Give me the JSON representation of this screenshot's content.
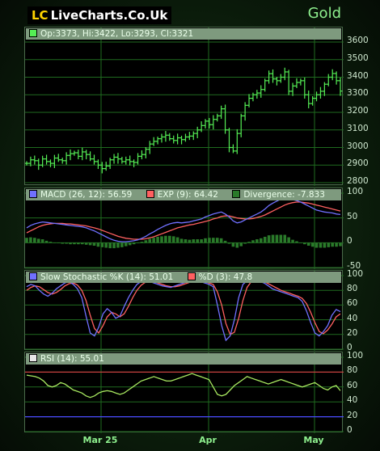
{
  "logo": {
    "lc": "LC",
    "text": "LiveCharts.Co.Uk"
  },
  "instrument": "Gold",
  "colors": {
    "up": "#55ee55",
    "macd": "#7070ff",
    "signal": "#ff6060",
    "hist": "#2a7a2a",
    "rsi": "#a8e860",
    "grid": "#1f6b1f",
    "ref_red": "#c84040",
    "ref_blue": "#4a4aff"
  },
  "x_labels": [
    "Mar 25",
    "Apr",
    "May"
  ],
  "chart_data": [
    {
      "type": "line",
      "style": "ohlc-bars",
      "legend": "Op:3373, Hi:3422, Lo:3293, Cl:3321",
      "y_ticks": [
        "3600",
        "3500",
        "3400",
        "3300",
        "3200",
        "3100",
        "3000",
        "2900",
        "2800"
      ],
      "ylim": [
        2800,
        3600
      ],
      "closes": [
        2910,
        2930,
        2925,
        2900,
        2935,
        2920,
        2910,
        2940,
        2930,
        2925,
        2955,
        2965,
        2970,
        2950,
        2975,
        2960,
        2935,
        2920,
        2900,
        2880,
        2895,
        2930,
        2945,
        2935,
        2920,
        2930,
        2920,
        2915,
        2950,
        2960,
        2990,
        3020,
        3035,
        3050,
        3060,
        3070,
        3050,
        3040,
        3055,
        3045,
        3060,
        3065,
        3080,
        3100,
        3125,
        3150,
        3130,
        3160,
        3180,
        3220,
        3100,
        3000,
        2980,
        3080,
        3180,
        3240,
        3280,
        3300,
        3310,
        3330,
        3380,
        3420,
        3390,
        3380,
        3400,
        3430,
        3320,
        3350,
        3370,
        3380,
        3300,
        3250,
        3280,
        3300,
        3320,
        3360,
        3400,
        3421,
        3380,
        3321
      ]
    },
    {
      "type": "line",
      "legend": [
        "MACD (26, 12): 56.59",
        "EXP (9): 64.42",
        "Divergence: -7.833"
      ],
      "y_ticks": [
        "100",
        "50",
        "0",
        "-50"
      ],
      "ylim": [
        -50,
        100
      ],
      "macd": [
        30,
        35,
        38,
        40,
        42,
        41,
        40,
        39,
        38,
        37,
        36,
        35,
        34,
        33,
        32,
        30,
        27,
        24,
        20,
        16,
        12,
        8,
        5,
        3,
        2,
        2,
        3,
        4,
        6,
        9,
        13,
        18,
        22,
        27,
        31,
        35,
        38,
        40,
        41,
        40,
        41,
        42,
        44,
        46,
        48,
        52,
        55,
        58,
        60,
        62,
        58,
        52,
        44,
        40,
        42,
        46,
        50,
        54,
        58,
        62,
        68,
        75,
        80,
        84,
        88,
        92,
        90,
        87,
        85,
        82,
        78,
        74,
        70,
        66,
        64,
        62,
        61,
        60,
        58,
        57
      ],
      "signal": [
        20,
        24,
        28,
        32,
        35,
        37,
        38,
        39,
        39,
        39,
        38,
        38,
        37,
        36,
        35,
        34,
        32,
        30,
        28,
        25,
        22,
        19,
        16,
        13,
        11,
        9,
        8,
        7,
        7,
        7,
        8,
        10,
        12,
        15,
        18,
        21,
        24,
        27,
        30,
        32,
        34,
        36,
        37,
        39,
        41,
        43,
        45,
        48,
        50,
        53,
        54,
        54,
        52,
        50,
        49,
        48,
        48,
        49,
        51,
        53,
        56,
        60,
        64,
        68,
        72,
        76,
        79,
        81,
        82,
        82,
        81,
        80,
        78,
        76,
        74,
        72,
        70,
        68,
        66,
        64
      ]
    },
    {
      "type": "line",
      "legend": [
        "Slow Stochastic %K (14): 51.01",
        "%D (3): 47.8"
      ],
      "y_ticks": [
        "100",
        "80",
        "60",
        "40",
        "20",
        "0"
      ],
      "ylim": [
        0,
        100
      ],
      "k": [
        85,
        88,
        86,
        80,
        75,
        72,
        76,
        82,
        86,
        90,
        92,
        88,
        82,
        70,
        45,
        22,
        18,
        30,
        48,
        55,
        50,
        42,
        45,
        58,
        70,
        80,
        88,
        92,
        93,
        92,
        90,
        88,
        86,
        85,
        84,
        86,
        88,
        90,
        92,
        93,
        94,
        92,
        90,
        88,
        85,
        60,
        32,
        12,
        18,
        40,
        70,
        88,
        93,
        95,
        94,
        92,
        90,
        86,
        82,
        80,
        78,
        76,
        74,
        72,
        70,
        65,
        52,
        36,
        22,
        18,
        24,
        32,
        46,
        54,
        51
      ],
      "d": [
        80,
        84,
        86,
        85,
        81,
        77,
        75,
        77,
        81,
        86,
        89,
        90,
        87,
        80,
        66,
        46,
        28,
        22,
        32,
        44,
        50,
        48,
        44,
        48,
        58,
        70,
        80,
        87,
        91,
        92,
        92,
        90,
        88,
        86,
        85,
        85,
        86,
        88,
        90,
        92,
        93,
        93,
        92,
        90,
        88,
        78,
        60,
        35,
        20,
        23,
        42,
        66,
        84,
        92,
        94,
        94,
        92,
        89,
        86,
        83,
        80,
        78,
        76,
        74,
        72,
        69,
        62,
        50,
        36,
        24,
        21,
        26,
        34,
        44,
        48
      ]
    },
    {
      "type": "line",
      "legend": [
        "RSI (14): 55.01"
      ],
      "y_ticks": [
        "100",
        "80",
        "60",
        "40",
        "20",
        "0"
      ],
      "ylim": [
        0,
        100
      ],
      "ref_lines": [
        80,
        20
      ],
      "rsi": [
        76,
        75,
        74,
        72,
        68,
        62,
        60,
        62,
        66,
        64,
        60,
        56,
        54,
        52,
        48,
        46,
        48,
        52,
        54,
        55,
        54,
        52,
        50,
        52,
        56,
        60,
        64,
        68,
        70,
        72,
        74,
        72,
        70,
        68,
        68,
        70,
        72,
        74,
        76,
        78,
        76,
        74,
        72,
        70,
        60,
        50,
        48,
        50,
        56,
        62,
        66,
        70,
        74,
        72,
        70,
        68,
        66,
        64,
        66,
        68,
        70,
        68,
        66,
        64,
        62,
        60,
        62,
        64,
        66,
        62,
        58,
        56,
        60,
        62,
        55
      ]
    }
  ]
}
